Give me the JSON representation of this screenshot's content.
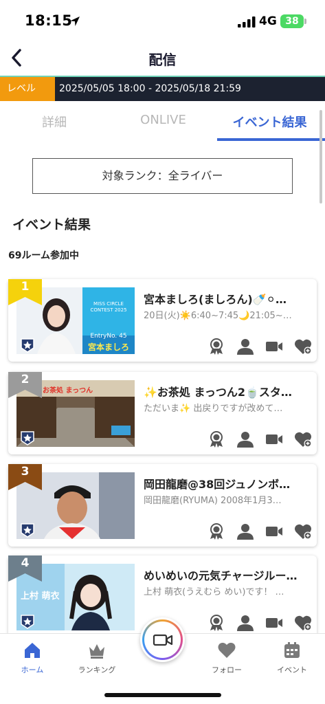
{
  "status": {
    "time": "18:15",
    "network": "4G",
    "battery": "38"
  },
  "header": {
    "title": "配信"
  },
  "period": {
    "label": "レベル",
    "range": "2025/05/05 18:00 - 2025/05/18 21:59"
  },
  "tabs": [
    {
      "label": "詳細",
      "active": false
    },
    {
      "label": "ONLIVE",
      "active": false
    },
    {
      "label": "イベント結果",
      "active": true
    }
  ],
  "rank_select": {
    "value": "対象ランク：全ライバー"
  },
  "section": {
    "title": "イベント結果",
    "participants": "69ルーム参加中"
  },
  "results": [
    {
      "rank": "1",
      "rank_color": "#f5d20c",
      "title": "宮本ましろ(ましろん)🍼⚪…",
      "desc": "20日(火)☀️6:40~7:45🌙21:05~…",
      "thumb_text": "MISS CIRCLE CONTEST 2025",
      "thumb_entry": "EntryNo. 45",
      "thumb_name": "宮本ましろ"
    },
    {
      "rank": "2",
      "rank_color": "#9b9b9b",
      "title": "✨お茶処 まっつん2🍵スタ…",
      "desc": "ただいま✨ 出戻りですが改めて…",
      "thumb_text": "お茶処 まっつん"
    },
    {
      "rank": "3",
      "rank_color": "#8a4b14",
      "title": "岡田龍磨@38回ジュノンボ…",
      "desc": "岡田龍磨(RYUMA) 2008年1月3…",
      "thumb_text": ""
    },
    {
      "rank": "4",
      "rank_color": "#6d7f8c",
      "title": "めいめいの元気チャージルー…",
      "desc": "上村 萌衣(うえむら めい)です！ …",
      "thumb_text": "上村 萌衣"
    }
  ],
  "card_icons": [
    "award-icon",
    "profile-icon",
    "video-icon",
    "follow-heart-icon"
  ],
  "tabbar": [
    {
      "label": "ホーム",
      "icon": "home-icon",
      "active": true
    },
    {
      "label": "ランキング",
      "icon": "crown-icon",
      "active": false
    },
    {
      "label": "",
      "icon": "camera-icon",
      "active": false
    },
    {
      "label": "フォロー",
      "icon": "heart-icon",
      "active": false
    },
    {
      "label": "イベント",
      "icon": "calendar-icon",
      "active": false
    }
  ]
}
